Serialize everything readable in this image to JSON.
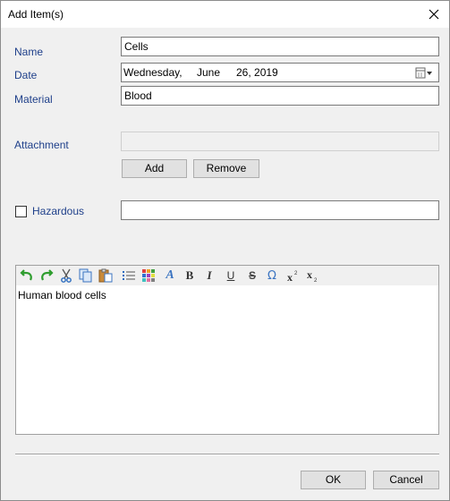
{
  "window": {
    "title": "Add Item(s)"
  },
  "form": {
    "name_label": "Name",
    "name_value": "Cells",
    "date_label": "Date",
    "date_weekday": "Wednesday,",
    "date_month": "June",
    "date_day_year": "26, 2019",
    "material_label": "Material",
    "material_value": "Blood",
    "attachment_label": "Attachment",
    "attachment_value": "",
    "add_label": "Add",
    "remove_label": "Remove",
    "hazardous_label": "Hazardous",
    "hazardous_checked": false,
    "hazardous_value": ""
  },
  "editor": {
    "content": "Human blood cells",
    "toolbar": [
      "undo-icon",
      "redo-icon",
      "cut-icon",
      "copy-icon",
      "paste-icon",
      "bullet-list-icon",
      "color-grid-icon",
      "font-style-icon",
      "bold-icon",
      "italic-icon",
      "underline-icon",
      "strikethrough-icon",
      "omega-icon",
      "superscript-icon",
      "subscript-icon"
    ],
    "bold_glyph": "B",
    "italic_glyph": "I",
    "underline_glyph": "U",
    "strike_glyph": "S",
    "omega_glyph": "Ω",
    "font_glyph": "A"
  },
  "footer": {
    "ok_label": "OK",
    "cancel_label": "Cancel"
  },
  "colors": {
    "label": "#1e3f8a",
    "background": "#f0f0f0",
    "button": "#e1e1e1"
  }
}
